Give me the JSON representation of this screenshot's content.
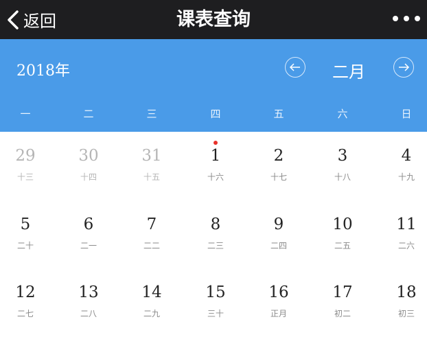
{
  "nav": {
    "back_label": "返回",
    "title": "课表查询",
    "more_icon": "more-dots-icon"
  },
  "calendar": {
    "year_label": "2018年",
    "month_label": "二月",
    "accent_color": "#4a9be8",
    "header_bg": "#1e1e20",
    "weekdays": [
      "一",
      "二",
      "三",
      "四",
      "五",
      "六",
      "日"
    ],
    "weeks": [
      [
        {
          "day": "29",
          "lunar": "十三",
          "other": true
        },
        {
          "day": "30",
          "lunar": "十四",
          "other": true
        },
        {
          "day": "31",
          "lunar": "十五",
          "other": true
        },
        {
          "day": "1",
          "lunar": "十六",
          "marked": true
        },
        {
          "day": "2",
          "lunar": "十七"
        },
        {
          "day": "3",
          "lunar": "十八"
        },
        {
          "day": "4",
          "lunar": "十九"
        }
      ],
      [
        {
          "day": "5",
          "lunar": "二十"
        },
        {
          "day": "6",
          "lunar": "二一"
        },
        {
          "day": "7",
          "lunar": "二二"
        },
        {
          "day": "8",
          "lunar": "二三"
        },
        {
          "day": "9",
          "lunar": "二四"
        },
        {
          "day": "10",
          "lunar": "二五"
        },
        {
          "day": "11",
          "lunar": "二六"
        }
      ],
      [
        {
          "day": "12",
          "lunar": "二七"
        },
        {
          "day": "13",
          "lunar": "二八"
        },
        {
          "day": "14",
          "lunar": "二九"
        },
        {
          "day": "15",
          "lunar": "三十"
        },
        {
          "day": "16",
          "lunar": "正月"
        },
        {
          "day": "17",
          "lunar": "初二"
        },
        {
          "day": "18",
          "lunar": "初三"
        }
      ]
    ]
  }
}
